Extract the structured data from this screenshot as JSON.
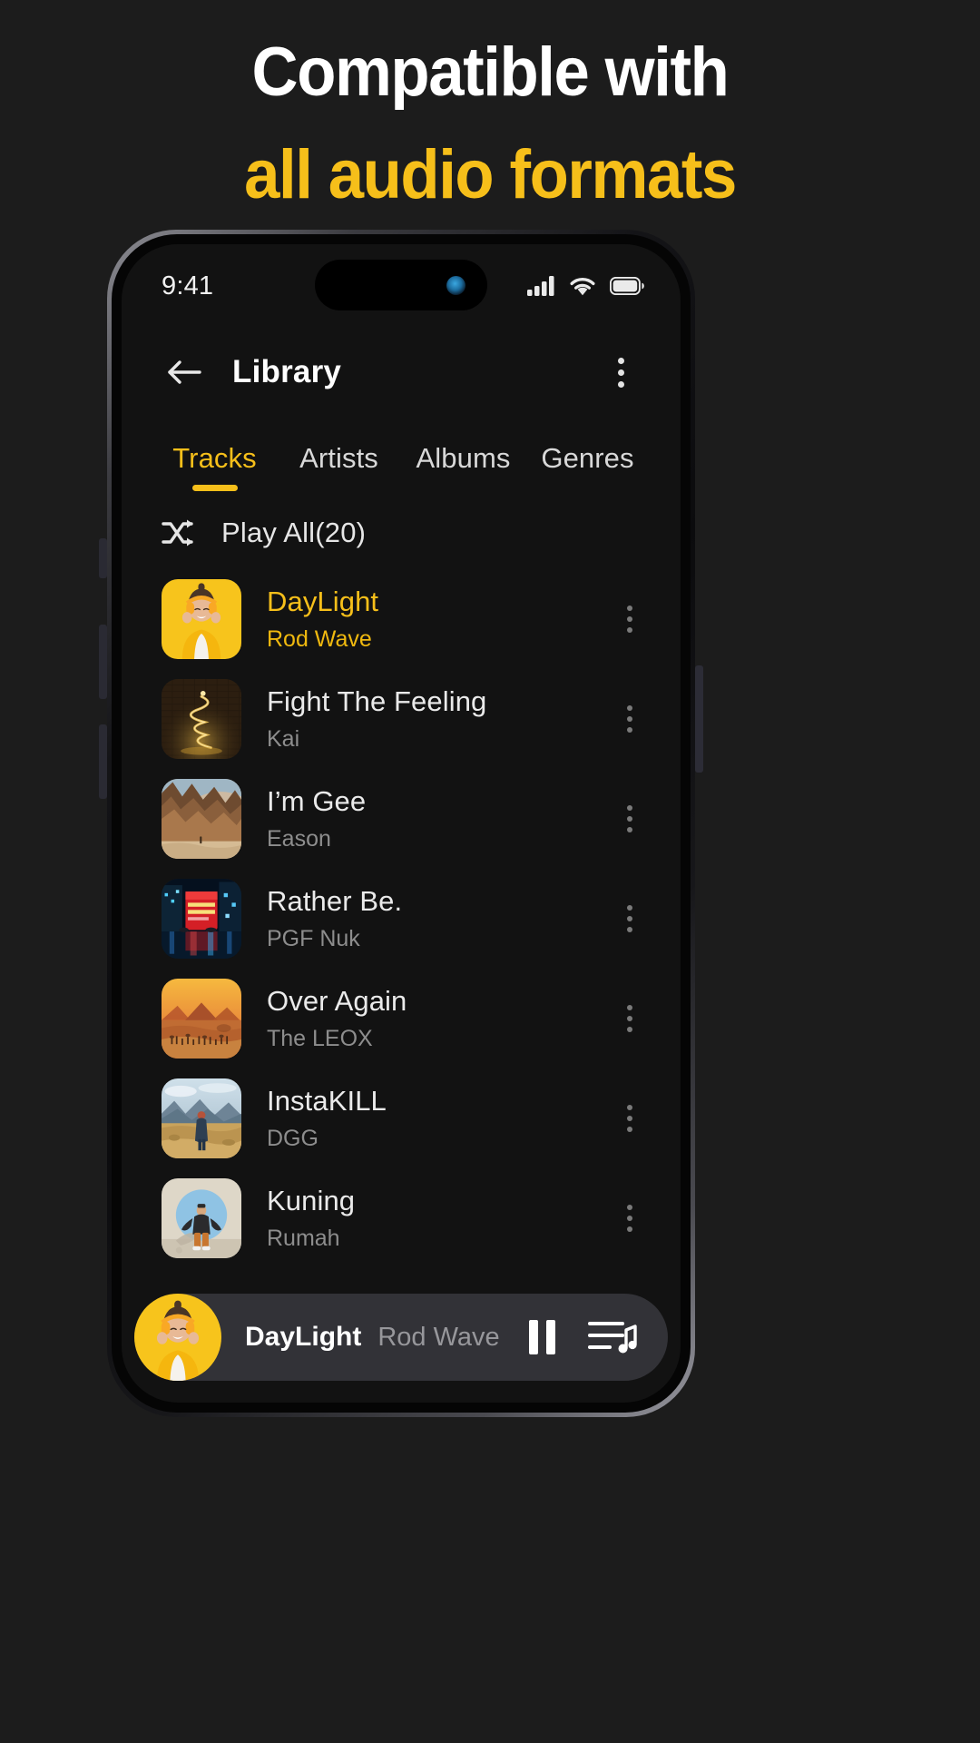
{
  "promo": {
    "line1": "Compatible with",
    "line2": "all audio formats",
    "accent_color": "#f6bf1a"
  },
  "status_bar": {
    "time": "9:41",
    "icons": [
      "signal-bars-icon",
      "wifi-icon",
      "battery-icon"
    ]
  },
  "header": {
    "back_icon": "arrow-left-icon",
    "title": "Library",
    "overflow_icon": "more-vertical-icon"
  },
  "tabs": [
    {
      "label": "Tracks",
      "active": true
    },
    {
      "label": "Artists",
      "active": false
    },
    {
      "label": "Albums",
      "active": false
    },
    {
      "label": "Genres",
      "active": false
    }
  ],
  "play_all": {
    "icon": "shuffle-icon",
    "label": "Play All(20)"
  },
  "tracks": [
    {
      "title": "DayLight",
      "artist": "Rod Wave",
      "playing": true,
      "art": "woman-yellow-headphones"
    },
    {
      "title": "Fight The Feeling",
      "artist": "Kai",
      "playing": false,
      "art": "golden-spiral-tree"
    },
    {
      "title": "I’m Gee",
      "artist": "Eason",
      "playing": false,
      "art": "desert-canyon"
    },
    {
      "title": "Rather Be.",
      "artist": "PGF Nuk",
      "playing": false,
      "art": "neon-city-night"
    },
    {
      "title": "Over Again",
      "artist": "The LEOX",
      "playing": false,
      "art": "orange-savanna-sunset"
    },
    {
      "title": "InstaKILL",
      "artist": "DGG",
      "playing": false,
      "art": "person-in-field"
    },
    {
      "title": "Kuning",
      "artist": "Rumah",
      "playing": false,
      "art": "man-blue-circle"
    }
  ],
  "mini_player": {
    "title": "DayLight",
    "artist": "Rod Wave",
    "art": "woman-yellow-headphones",
    "pause_icon": "pause-icon",
    "queue_icon": "queue-music-icon"
  }
}
